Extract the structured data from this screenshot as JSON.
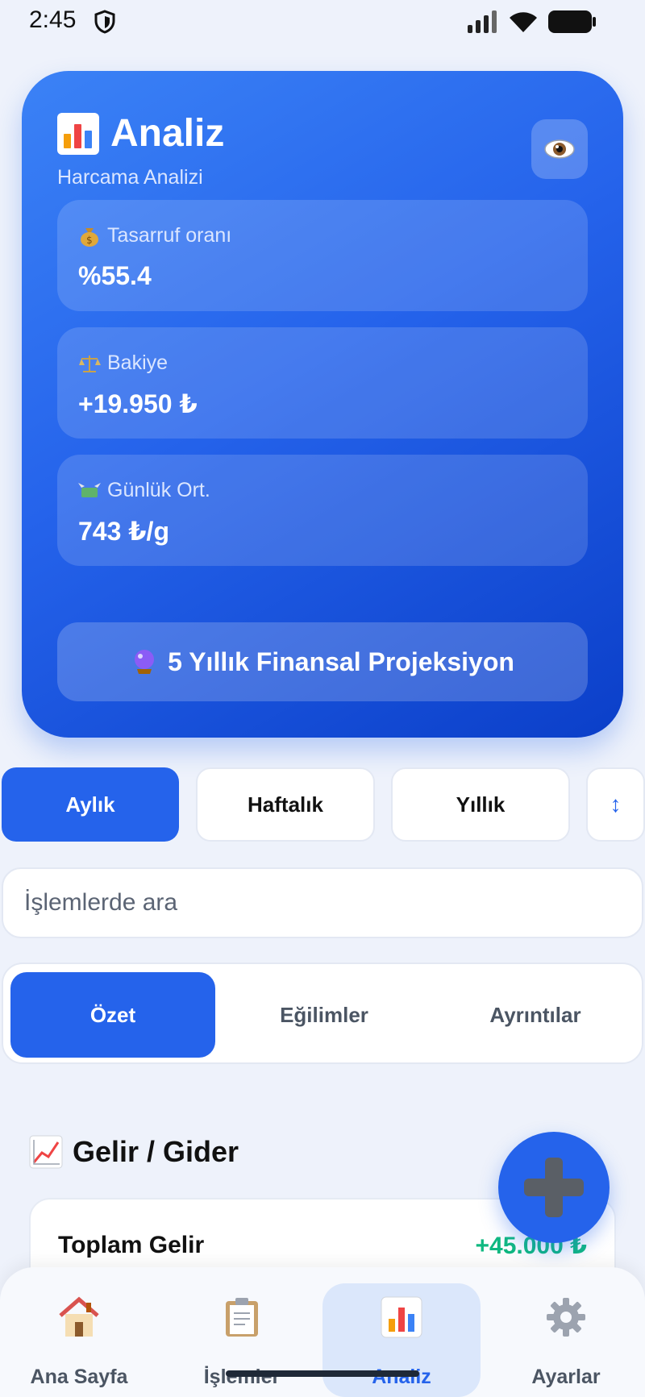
{
  "status": {
    "time": "2:45"
  },
  "header": {
    "title": "Analiz",
    "subtitle": "Harcama Analizi"
  },
  "stats": [
    {
      "icon": "money-bag-icon",
      "label": "Tasarruf oranı",
      "value": "%55.4"
    },
    {
      "icon": "scales-icon",
      "label": "Bakiye",
      "value": "+19.950 ₺"
    },
    {
      "icon": "money-wings-icon",
      "label": "Günlük Ort.",
      "value": "743 ₺/g"
    }
  ],
  "projection_button": {
    "label": "5 Yıllık Finansal Projeksiyon",
    "icon": "crystal-ball-icon"
  },
  "period_tabs": [
    {
      "label": "Aylık",
      "active": true
    },
    {
      "label": "Haftalık",
      "active": false
    },
    {
      "label": "Yıllık",
      "active": false
    }
  ],
  "sort_button": {
    "icon": "sort-arrow-icon",
    "glyph": "↕"
  },
  "search": {
    "placeholder": "İşlemlerde ara"
  },
  "view_tabs": [
    {
      "label": "Özet",
      "active": true
    },
    {
      "label": "Eğilimler",
      "active": false
    },
    {
      "label": "Ayrıntılar",
      "active": false
    }
  ],
  "income_expense": {
    "title": "Gelir / Gider",
    "rows": [
      {
        "label": "Toplam Gelir",
        "value": "+45.000 ₺"
      }
    ]
  },
  "bottom_nav": [
    {
      "label": "Ana Sayfa",
      "icon": "house-icon",
      "active": false
    },
    {
      "label": "İşlemler",
      "icon": "clipboard-icon",
      "active": false
    },
    {
      "label": "Analiz",
      "icon": "bar-chart-icon",
      "active": true
    },
    {
      "label": "Ayarlar",
      "icon": "gear-icon",
      "active": false
    }
  ],
  "colors": {
    "primary": "#2563eb",
    "positive": "#10b981",
    "background": "#eef2fb"
  }
}
